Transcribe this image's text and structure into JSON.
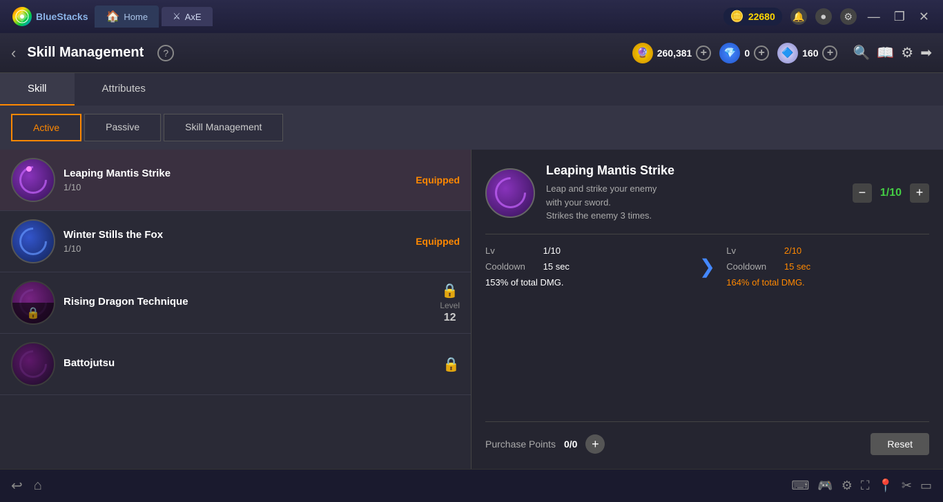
{
  "titleBar": {
    "appName": "BlueStacks",
    "tabs": [
      {
        "label": "Home",
        "active": false
      },
      {
        "label": "AxE",
        "active": true
      }
    ],
    "coins": "22680",
    "minimizeLabel": "—",
    "restoreLabel": "❐",
    "closeLabel": "✕"
  },
  "gameHeader": {
    "backLabel": "‹",
    "title": "Skill Management",
    "helpLabel": "?",
    "currencies": [
      {
        "value": "260,381",
        "type": "gold"
      },
      {
        "value": "0",
        "type": "blue"
      },
      {
        "value": "160",
        "type": "white"
      }
    ]
  },
  "topTabs": [
    {
      "label": "Skill",
      "active": true
    },
    {
      "label": "Attributes",
      "active": false
    }
  ],
  "subTabs": [
    {
      "label": "Active",
      "active": true
    },
    {
      "label": "Passive",
      "active": false
    },
    {
      "label": "Skill Management",
      "active": false
    }
  ],
  "skills": [
    {
      "name": "Leaping Mantis Strike",
      "level": "1/10",
      "status": "Equipped",
      "locked": false,
      "type": "leaping"
    },
    {
      "name": "Winter Stills the Fox",
      "level": "1/10",
      "status": "Equipped",
      "locked": false,
      "type": "winter"
    },
    {
      "name": "Rising Dragon Technique",
      "level": "",
      "lockLevel": "Level",
      "lockLevelNum": "12",
      "locked": true,
      "type": "dragon"
    },
    {
      "name": "Battojutsu",
      "level": "",
      "locked": true,
      "type": "battojutsu"
    }
  ],
  "skillDetail": {
    "name": "Leaping Mantis Strike",
    "description": "Leap and strike your enemy\nwith your sword.\nStrikes the enemy 3 times.",
    "level": "1/10",
    "levelColor": "#44cc44",
    "stats": {
      "current": {
        "lv": "1/10",
        "cooldown": "15 sec",
        "dmg": "153% of total DMG."
      },
      "next": {
        "lv": "2/10",
        "cooldown": "15 sec",
        "dmg": "164% of total DMG."
      }
    }
  },
  "bottomBar": {
    "purchaseLabel": "Purchase Points",
    "purchaseValue": "0/0",
    "resetLabel": "Reset"
  },
  "taskbar": {
    "backLabel": "↩",
    "homeLabel": "⌂"
  }
}
